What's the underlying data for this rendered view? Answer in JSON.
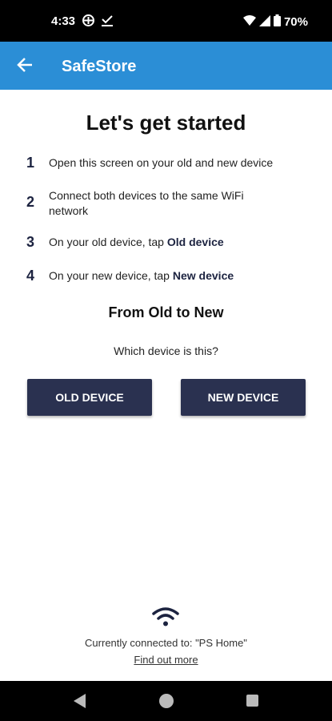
{
  "status_bar": {
    "time": "4:33",
    "battery": "70%",
    "icons": [
      "vpn-icon",
      "checkmark-icon",
      "wifi-icon",
      "signal-icon",
      "battery-icon"
    ]
  },
  "app_bar": {
    "title": "SafeStore",
    "color": "#2b8ed6"
  },
  "main": {
    "heading": "Let's get started",
    "steps": [
      {
        "num": "1",
        "text": "Open this screen on your old and new device",
        "bold": ""
      },
      {
        "num": "2",
        "text": "Connect both devices to the same WiFi network",
        "bold": ""
      },
      {
        "num": "3",
        "text": "On your old device, tap ",
        "bold": "Old device"
      },
      {
        "num": "4",
        "text": "On your new device, tap ",
        "bold": "New device"
      }
    ],
    "subheading": "From Old to New",
    "question": "Which device is this?",
    "old_button": "OLD DEVICE",
    "new_button": "NEW DEVICE",
    "button_color": "#2a3150"
  },
  "footer": {
    "connected_text": "Currently connected to: \"PS Home\"",
    "find_out_link": "Find out more"
  }
}
